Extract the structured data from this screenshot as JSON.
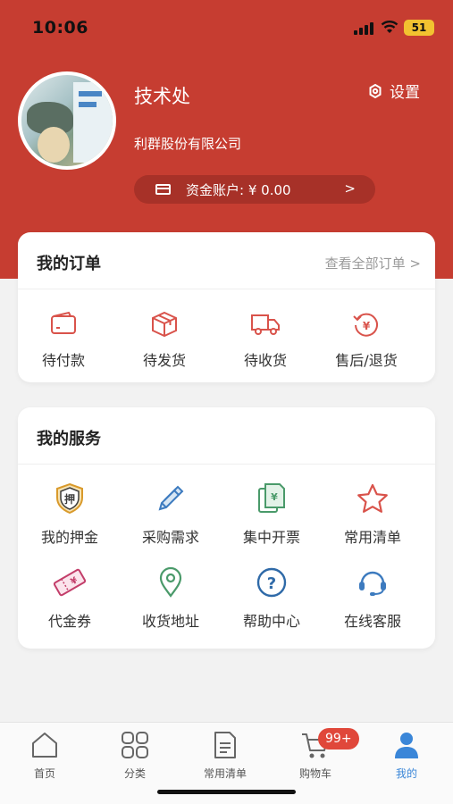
{
  "status_bar": {
    "time": "10:06",
    "battery": "51"
  },
  "profile": {
    "name": "技术处",
    "company": "利群股份有限公司",
    "settings_label": "设置",
    "account_label": "资金账户:",
    "account_currency": "¥",
    "account_amount": "0.00",
    "account_chevron": ">"
  },
  "orders": {
    "title": "我的订单",
    "view_all": "查看全部订单 >",
    "items": [
      {
        "label": "待付款",
        "icon": "wallet-icon"
      },
      {
        "label": "待发货",
        "icon": "box-icon"
      },
      {
        "label": "待收货",
        "icon": "truck-icon"
      },
      {
        "label": "售后/退货",
        "icon": "refund-icon"
      }
    ]
  },
  "services": {
    "title": "我的服务",
    "items": [
      {
        "label": "我的押金",
        "icon": "deposit-shield-icon"
      },
      {
        "label": "采购需求",
        "icon": "pencil-icon"
      },
      {
        "label": "集中开票",
        "icon": "invoice-icon"
      },
      {
        "label": "常用清单",
        "icon": "star-icon"
      },
      {
        "label": "代金券",
        "icon": "coupon-icon"
      },
      {
        "label": "收货地址",
        "icon": "location-pin-icon"
      },
      {
        "label": "帮助中心",
        "icon": "help-icon"
      },
      {
        "label": "在线客服",
        "icon": "headset-icon"
      }
    ]
  },
  "tabbar": {
    "items": [
      {
        "label": "首页",
        "icon": "home-icon"
      },
      {
        "label": "分类",
        "icon": "grid-icon"
      },
      {
        "label": "常用清单",
        "icon": "list-icon"
      },
      {
        "label": "购物车",
        "icon": "cart-icon"
      },
      {
        "label": "我的",
        "icon": "user-icon"
      }
    ],
    "cart_badge": "99+",
    "active": "我的"
  },
  "colors": {
    "brand": "#c63d31",
    "active_tab": "#3a86d8",
    "icon_red": "#d9534b",
    "icon_blue": "#3d7bbf",
    "icon_green": "#4a9a6a"
  }
}
